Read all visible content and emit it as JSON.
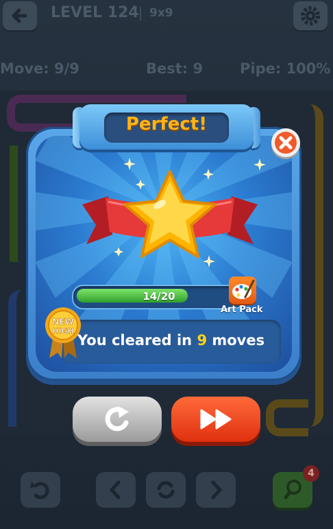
{
  "header": {
    "level_title": "LEVEL 124",
    "grid_size": "9x9"
  },
  "stats": {
    "move": "Move: 9/9",
    "best": "Best: 9",
    "pipe": "Pipe: 100%"
  },
  "dialog": {
    "title": "Perfect!",
    "progress": {
      "text": "14/20",
      "current": 14,
      "total": 20
    },
    "art_pack_label": "Art Pack",
    "badge_line1": "NEW",
    "badge_line2": "HIGH",
    "result_prefix": "You cleared in",
    "result_moves": "9",
    "result_suffix": "moves",
    "stars_rating": 1
  },
  "toolbar": {
    "hint_count": "4"
  },
  "colors": {
    "accent_orange": "#ffb31a",
    "progress_green": "#2fa02a",
    "next_button_red": "#e0300f",
    "dialog_blue": "#2b7bd0"
  },
  "icons": [
    "back-arrow-icon",
    "gear-icon",
    "close-icon",
    "star-icon",
    "palette-icon",
    "replay-icon",
    "fast-forward-icon",
    "undo-icon",
    "chevron-left-icon",
    "restart-icon",
    "chevron-right-icon",
    "lightbulb-icon"
  ]
}
